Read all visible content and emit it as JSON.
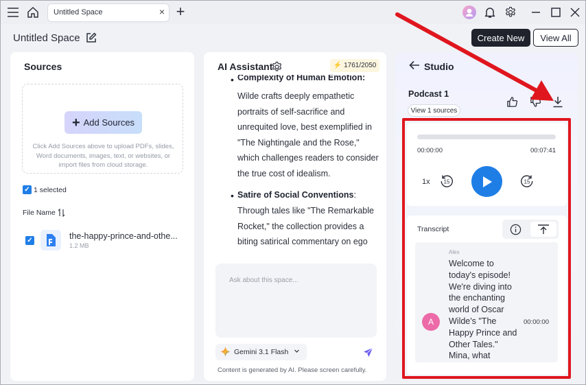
{
  "titlebar": {
    "tab_label": "Untitled Space",
    "tab_close": "×",
    "new_tab": "+"
  },
  "header": {
    "space_title": "Untitled Space",
    "create_new": "Create New",
    "view_all": "View All"
  },
  "sources": {
    "title": "Sources",
    "add_label": "Add Sources",
    "help": "Click Add Sources above to upload PDFs, slides, Word documents, images, text, or websites, or import files from cloud storage.",
    "selected": "1 selected",
    "column": "File Name",
    "files": [
      {
        "name": "the-happy-prince-and-othe...",
        "size": "1.2 MB"
      }
    ]
  },
  "assistant": {
    "title": "AI Assistant",
    "credits": "1761/2050",
    "partial_heading": "Complexity of Human Emotion",
    "partial_lines": [
      "Wilde crafts deeply empathetic",
      "portraits of self-sacrifice and",
      "unrequited love, best exemplified in",
      "\"The Nightingale and the Rose,\"",
      "which challenges readers to consider",
      "the true cost of idealism."
    ],
    "bullet2_heading": "Satire of Social Conventions",
    "bullet2_lines": [
      "Through tales like \"The Remarkable",
      "Rocket,\" the collection provides a",
      "biting satirical commentary on ego"
    ],
    "input_placeholder": "Ask about this space...",
    "model": "Gemini 3.1 Flash",
    "disclaimer": "Content is generated by AI. Please screen carefully."
  },
  "studio": {
    "title": "Studio",
    "podcast_title": "Podcast 1",
    "view_sources": "View 1 sources",
    "time_start": "00:00:00",
    "time_end": "00:07:41",
    "progress": 0,
    "speed": "1x",
    "skip_back": "15",
    "skip_forward": "15",
    "transcript_label": "Transcript",
    "speaker": "Alex",
    "avatar_letter": "A",
    "transcript_text": "Welcome to today's episode! We're diving into the enchanting world of Oscar Wilde's \"The Happy Prince and Other Tales.\" Mina, what",
    "transcript_time": "00:00:00"
  },
  "colors": {
    "accent": "#1f7ee6",
    "annotation_red": "#e0161e",
    "avatar_pink": "#ec6aa8"
  }
}
